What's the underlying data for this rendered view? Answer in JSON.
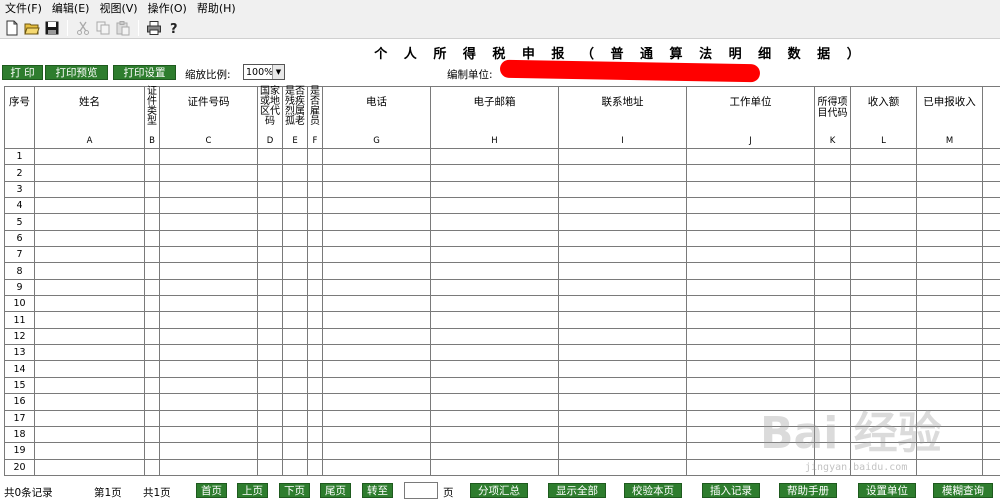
{
  "menu": [
    "文件(F)",
    "编辑(E)",
    "视图(V)",
    "操作(O)",
    "帮助(H)"
  ],
  "toolbar_icons": [
    "new-file-icon",
    "open-folder-icon",
    "save-icon",
    "cut-icon",
    "copy-icon",
    "paste-icon",
    "print-icon",
    "help-icon"
  ],
  "report_title": "个 人 所 得 税 申 报 （ 普 通 算 法 明 细 数 据 ）",
  "buttons": {
    "print": "打 印",
    "print_preview": "打印预览",
    "print_settings": "打印设置"
  },
  "zoom": {
    "label": "缩放比例:",
    "value": "100%"
  },
  "unit_label": "编制单位:",
  "columns": [
    {
      "title": "序号",
      "letter": ""
    },
    {
      "title": "姓名",
      "letter": "A"
    },
    {
      "title": "证件类型",
      "letter": "B"
    },
    {
      "title": "证件号码",
      "letter": "C"
    },
    {
      "title": "国家或地区代码",
      "letter": "D"
    },
    {
      "title": "是否残疾烈属孤老",
      "letter": "E"
    },
    {
      "title": "是否雇员",
      "letter": "F"
    },
    {
      "title": "电话",
      "letter": "G"
    },
    {
      "title": "电子邮箱",
      "letter": "H"
    },
    {
      "title": "联系地址",
      "letter": "I"
    },
    {
      "title": "工作单位",
      "letter": "J"
    },
    {
      "title": "所得项目代码",
      "letter": "K"
    },
    {
      "title": "收入额",
      "letter": "L"
    },
    {
      "title": "已申报收入",
      "letter": "M"
    },
    {
      "title": "",
      "letter": ""
    }
  ],
  "rows": [
    "1",
    "2",
    "3",
    "4",
    "5",
    "6",
    "7",
    "8",
    "9",
    "10",
    "11",
    "12",
    "13",
    "14",
    "15",
    "16",
    "17",
    "18",
    "19",
    "20"
  ],
  "status": {
    "records": "共0条记录",
    "current_page": "第1页",
    "total_pages": "共1页",
    "page_unit": "页"
  },
  "nav_buttons": {
    "first": "首页",
    "prev": "上页",
    "next": "下页",
    "last": "尾页",
    "goto": "转至",
    "subtotal": "分项汇总",
    "show_all": "显示全部",
    "validate": "校验本页",
    "insert": "插入记录",
    "manual": "帮助手册",
    "set_unit": "设置单位",
    "fuzzy": "模糊查询"
  },
  "watermark": {
    "text": "Bai 经验",
    "sub": "jingyan.baidu.com"
  },
  "colors": {
    "button_green": "#2e7d2e",
    "redaction": "#ff0000"
  }
}
